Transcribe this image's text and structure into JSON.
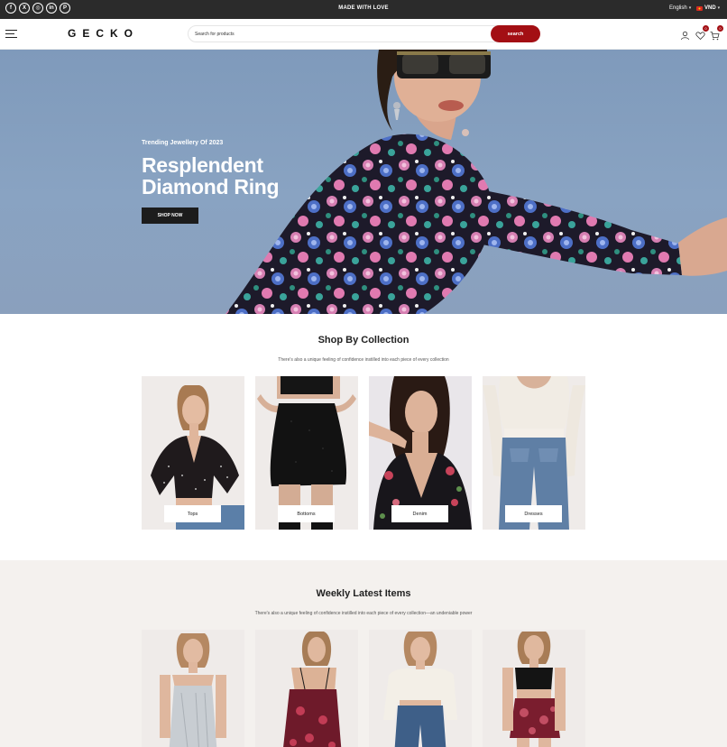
{
  "topbar": {
    "socials": [
      {
        "icon": "facebook-icon",
        "glyph": "f"
      },
      {
        "icon": "x-twitter-icon",
        "glyph": "X"
      },
      {
        "icon": "instagram-icon",
        "glyph": "◎"
      },
      {
        "icon": "linkedin-icon",
        "glyph": "in"
      },
      {
        "icon": "pinterest-icon",
        "glyph": "P"
      }
    ],
    "message": "MADE WITH LOVE",
    "language": "English",
    "currency": "VND"
  },
  "header": {
    "logo": "GECKO",
    "search_placeholder": "Search for products",
    "search_button": "search",
    "wishlist_count": "0",
    "cart_count": "0"
  },
  "hero": {
    "subtitle": "Trending Jewellery Of 2023",
    "title_line1": "Resplendent",
    "title_line2": "Diamond Ring",
    "button": "SHOP NOW"
  },
  "collections": {
    "title": "Shop By Collection",
    "subtitle": "There's also a unique feeling of confidence instilled into each piece of every collection",
    "items": [
      {
        "label": "Tops"
      },
      {
        "label": "Bottoms"
      },
      {
        "label": "Denim"
      },
      {
        "label": "Dresses"
      }
    ]
  },
  "weekly": {
    "title": "Weekly Latest Items",
    "subtitle": "There's also a unique feeling of confidence instilled into each piece of every collection—an undeniable power"
  },
  "colors": {
    "accent": "#a30f14",
    "topbar": "#2b2b2b",
    "hero_sky": "#86a0c0"
  }
}
